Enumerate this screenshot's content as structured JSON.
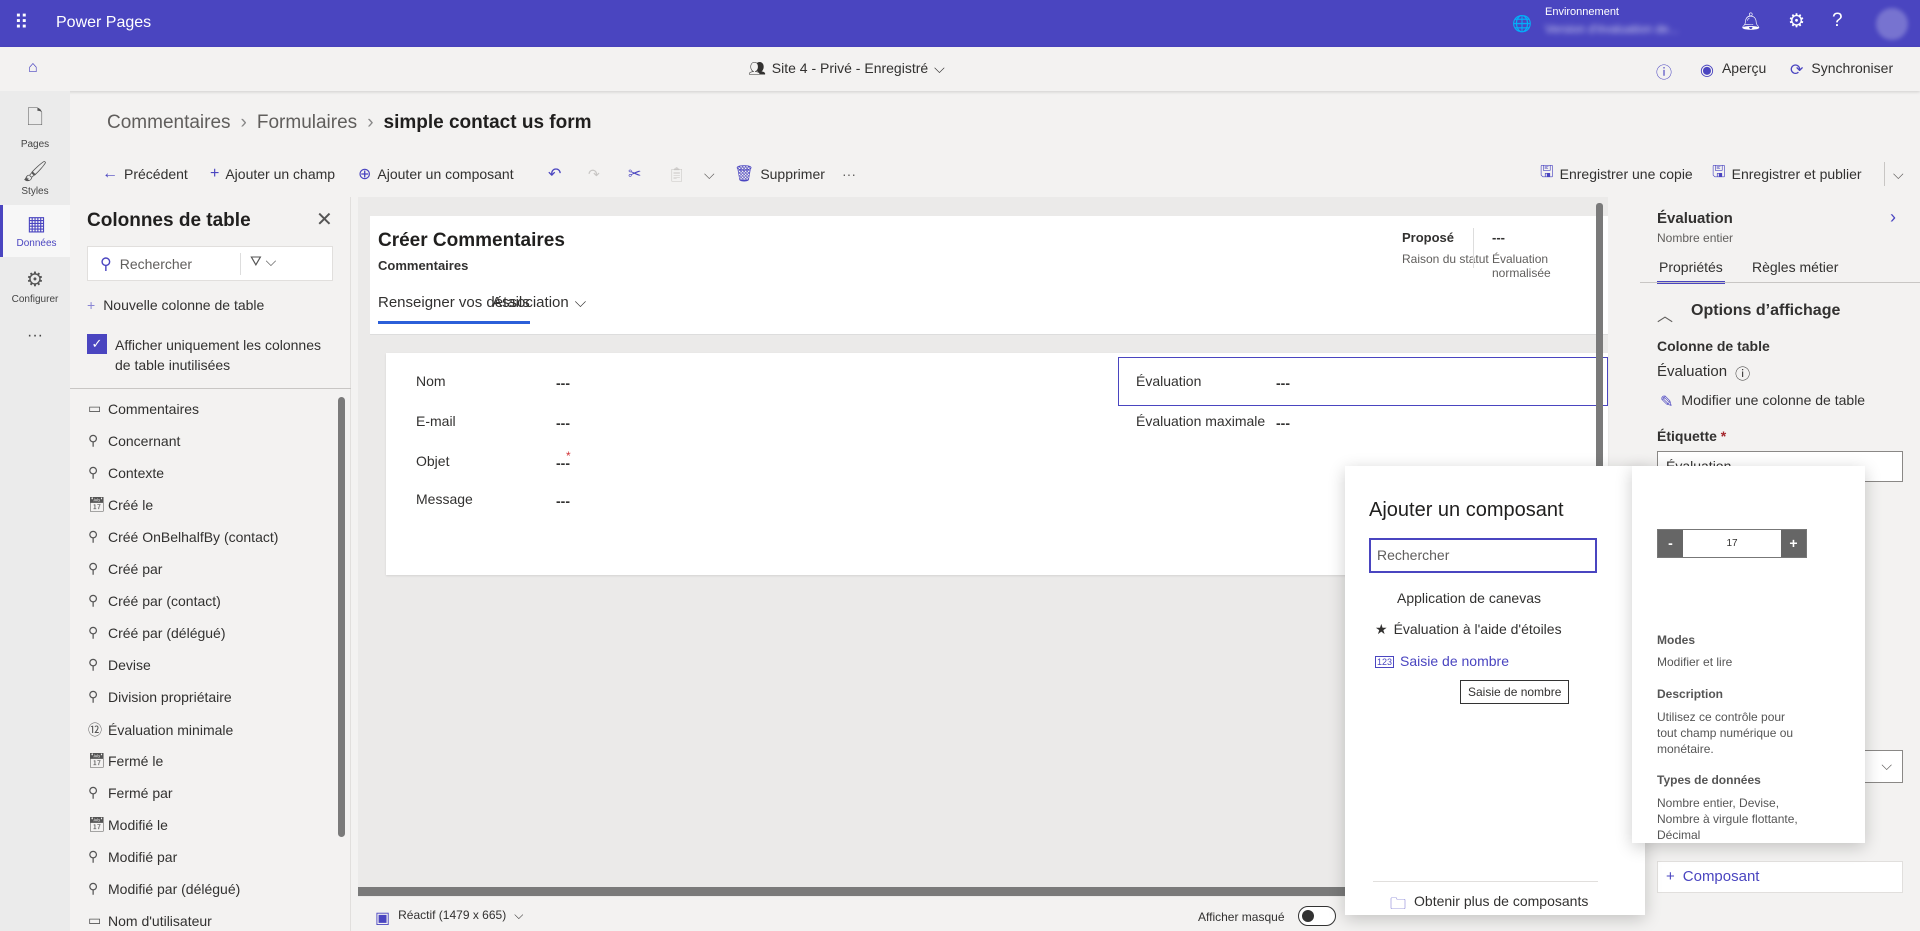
{
  "app": {
    "title": "Power Pages",
    "env_label": "Environnement",
    "env_value": "Version d'évaluation de..."
  },
  "subbar": {
    "site": "Site 4 - Privé - Enregistré",
    "preview": "Aperçu",
    "sync": "Synchroniser"
  },
  "rail": [
    {
      "label": "Pages",
      "icon": "page-icon"
    },
    {
      "label": "Styles",
      "icon": "brush-icon"
    },
    {
      "label": "Données",
      "icon": "table-icon"
    },
    {
      "label": "Configurer",
      "icon": "configure-icon"
    }
  ],
  "breadcrumb": [
    "Commentaires",
    "Formulaires",
    "simple contact us form"
  ],
  "toolbar": {
    "back": "Précédent",
    "add_field": "Ajouter un champ",
    "add_component": "Ajouter un composant",
    "delete": "Supprimer",
    "save_copy": "Enregistrer une copie",
    "save_publish": "Enregistrer et publier"
  },
  "leftpanel": {
    "title": "Colonnes de table",
    "search_placeholder": "Rechercher",
    "new_column": "Nouvelle colonne de table",
    "checkbox_label": "Afficher uniquement les colonnes de table inutilisées",
    "checkbox_checked": true,
    "items": [
      "Commentaires",
      "Concernant",
      "Contexte",
      "Créé le",
      "Créé OnBelhalfBy (contact)",
      "Créé par",
      "Créé par (contact)",
      "Créé par (délégué)",
      "Devise",
      "Division propriétaire",
      "Évaluation minimale",
      "Fermé le",
      "Fermé par",
      "Modifié le",
      "Modifié par",
      "Modifié par (délégué)",
      "Nom d'utilisateur"
    ]
  },
  "form": {
    "title": "Créer Commentaires",
    "subtitle": "Commentaires",
    "status_value": "Proposé",
    "status_label": "Raison du statut",
    "norm_value": "---",
    "norm_label": "Évaluation normalisée",
    "tabs": [
      "Renseigner vos détails",
      "Association"
    ],
    "fields_left": [
      {
        "label": "Nom",
        "value": "---"
      },
      {
        "label": "E-mail",
        "value": "---"
      },
      {
        "label": "Objet",
        "value": "---",
        "required": "*"
      },
      {
        "label": "Message",
        "value": "---"
      }
    ],
    "fields_right": [
      {
        "label": "Évaluation",
        "value": "---"
      },
      {
        "label": "Évaluation maximale",
        "value": "---"
      }
    ]
  },
  "bottombar": {
    "responsive": "Réactif (1479 x 665)",
    "show_hidden": "Afficher masqué"
  },
  "rightpanel": {
    "title": "Évaluation",
    "subtitle": "Nombre entier",
    "tabs": [
      "Propriétés",
      "Règles métier"
    ],
    "section": "Options d’affichage",
    "column_label": "Colonne de table",
    "column_value": "Évaluation",
    "edit_column": "Modifier une colonne de table",
    "label_label": "Étiquette",
    "required": "*",
    "label_value": "Évaluation",
    "component_btn": "Composant"
  },
  "popup": {
    "title": "Ajouter un composant",
    "search_placeholder": "Rechercher",
    "items": [
      "Application de canevas",
      "Évaluation à l'aide d'étoiles",
      "Saisie de nombre"
    ],
    "tooltip": "Saisie de nombre",
    "more": "Obtenir plus de composants"
  },
  "flyout": {
    "stepper_minus": "-",
    "stepper_value": "17",
    "stepper_plus": "+",
    "modes_title": "Modes",
    "modes": "Modifier et lire",
    "desc_title": "Description",
    "desc": "Utilisez ce contrôle pour tout champ numérique ou monétaire.",
    "types_title": "Types de données",
    "types": "Nombre entier, Devise, Nombre à virgule flottante, Décimal"
  },
  "colors": {
    "brand": "#4a45c0",
    "tab_underline": "#2b5fd9"
  }
}
